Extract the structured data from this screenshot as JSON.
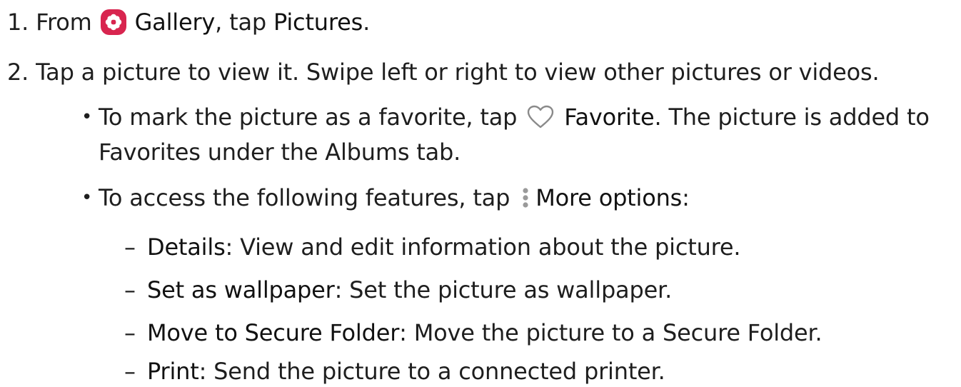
{
  "step1": {
    "number": "1.",
    "prefix": "From",
    "app": "Gallery",
    "middle": ", tap",
    "target": "Pictures",
    "suffix": "."
  },
  "step2": {
    "number": "2.",
    "text": "Tap a picture to view it. Swipe left or right to view other pictures or videos."
  },
  "bullet1": {
    "prefix": "To mark the picture as a favorite, tap",
    "action": "Favorite",
    "suffix": ". The picture is added to",
    "line2": "Favorites under the Albums tab."
  },
  "bullet2": {
    "prefix": "To access the following features, tap",
    "action": "More options",
    "suffix": ":"
  },
  "options": [
    {
      "term": "Details",
      "desc": ": View and edit information about the picture."
    },
    {
      "term": "Set as wallpaper",
      "desc": ": Set the picture as wallpaper."
    },
    {
      "term": "Move to Secure Folder",
      "desc": ": Move the picture to a Secure Folder."
    },
    {
      "term": "Print",
      "desc": ": Send the picture to a connected printer."
    }
  ],
  "symbols": {
    "bullet": "•",
    "dash": "–"
  },
  "icons": {
    "gallery": "gallery-flower-icon",
    "favorite": "heart-outline-icon",
    "more": "vertical-dots-icon"
  },
  "colors": {
    "gallery_icon_bg": "#d8254f",
    "heart_outline": "#8a8a8a",
    "dots": "#9a9a9a"
  }
}
